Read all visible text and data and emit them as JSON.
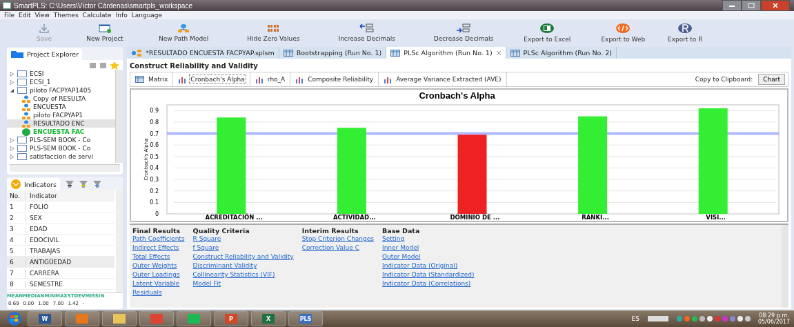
{
  "window": {
    "title": "SmartPLS: C:\\Users\\Víctor Cárdenas\\smartpls_workspace"
  },
  "menu": [
    "File",
    "Edit",
    "View",
    "Themes",
    "Calculate",
    "Info",
    "Language"
  ],
  "toolbar": [
    {
      "label": "Save",
      "disabled": true
    },
    {
      "label": "New Project",
      "disabled": false
    },
    {
      "label": "New Path Model",
      "disabled": false
    },
    {
      "label": "Hide Zero Values",
      "disabled": false
    },
    {
      "label": "Increase Decimals",
      "disabled": false
    },
    {
      "label": "Decrease Decimals",
      "disabled": false
    },
    {
      "label": "Export to Excel",
      "disabled": false
    },
    {
      "label": "Export to Web",
      "disabled": false
    },
    {
      "label": "Export to R",
      "disabled": false
    }
  ],
  "project_explorer": {
    "title": "Project Explorer",
    "items": [
      {
        "label": "ECSI",
        "kind": "project",
        "expanded": false,
        "selected": false
      },
      {
        "label": "ECSI_1",
        "kind": "project",
        "expanded": false,
        "selected": false
      },
      {
        "label": "piloto FACPYAP1405",
        "kind": "project",
        "expanded": true,
        "selected": false,
        "children": [
          {
            "label": "Copy of RESULTA",
            "kind": "model",
            "selected": false
          },
          {
            "label": "ENCUESTA",
            "kind": "model",
            "selected": false
          },
          {
            "label": "piloto FACPYAP1",
            "kind": "model",
            "selected": false
          },
          {
            "label": "RESULTADO ENC",
            "kind": "model",
            "selected": true
          },
          {
            "label": "ENCUESTA FAC",
            "kind": "data",
            "selected": false
          }
        ]
      },
      {
        "label": "PLS-SEM BOOK - Co",
        "kind": "project",
        "expanded": false,
        "selected": false
      },
      {
        "label": "PLS-SEM BOOK - Co",
        "kind": "project",
        "expanded": false,
        "selected": false
      },
      {
        "label": "satisfaccion de servi",
        "kind": "project",
        "expanded": false,
        "selected": false
      }
    ]
  },
  "indicators": {
    "title": "Indicators",
    "columns": [
      "No.",
      "Indicator"
    ],
    "rows": [
      {
        "no": "1",
        "name": "FOLIO",
        "selected": false
      },
      {
        "no": "2",
        "name": "SEX",
        "selected": false
      },
      {
        "no": "3",
        "name": "EDAD",
        "selected": false
      },
      {
        "no": "4",
        "name": "EDOCIVIL",
        "selected": false
      },
      {
        "no": "5",
        "name": "TRABAJAS",
        "selected": false
      },
      {
        "no": "6",
        "name": "ANTIGÜEDAD",
        "selected": true
      },
      {
        "no": "7",
        "name": "CARRERA",
        "selected": false
      },
      {
        "no": "8",
        "name": "SEMESTRE",
        "selected": false
      }
    ],
    "stats_columns": [
      "MEAN",
      "MEDIAN",
      "MIN",
      "MAX",
      "STDEV",
      "MISSIN"
    ],
    "stats_values": [
      "0.69",
      "0.00",
      "1.00",
      "7.00",
      "1.42",
      "-"
    ]
  },
  "editor_tabs": [
    {
      "label": "*RESULTADO ENCUESTA FACPYAP.splsm",
      "kind": "model",
      "selected": false,
      "closable": false
    },
    {
      "label": "Bootstrapping (Run No. 1)",
      "kind": "report",
      "selected": false,
      "closable": false
    },
    {
      "label": "PLSc Algorithm (Run No. 1)",
      "kind": "report",
      "selected": true,
      "closable": true
    },
    {
      "label": "PLSc Algorithm (Run No. 2)",
      "kind": "report",
      "selected": false,
      "closable": false
    }
  ],
  "report": {
    "title": "Construct Reliability and Validity",
    "view_tabs": [
      {
        "label": "Matrix",
        "kind": "matrix",
        "selected": false
      },
      {
        "label": "Cronbach's Alpha",
        "kind": "chart",
        "selected": true
      },
      {
        "label": "rho_A",
        "kind": "chart",
        "selected": false
      },
      {
        "label": "Composite Reliability",
        "kind": "chart",
        "selected": false
      },
      {
        "label": "Average Variance Extracted (AVE)",
        "kind": "chart",
        "selected": false
      }
    ],
    "clipboard_label": "Copy to Clipboard:",
    "clipboard_button": "Chart",
    "chart_data": {
      "type": "bar",
      "title": "Cronbach's Alpha",
      "ylabel": "Cronbach's Alpha",
      "categories": [
        "ACREDITACIÓN ...",
        "ACTIVIDAD...",
        "DOMINIO DE ...",
        "RANKI...",
        "VISI..."
      ],
      "series": [
        {
          "color": "#33ee33",
          "values": [
            0.84,
            0.75,
            null,
            0.85,
            0.92
          ]
        },
        {
          "color": "#ee2222",
          "values": [
            null,
            null,
            0.69,
            null,
            null
          ]
        }
      ],
      "ylim": [
        0,
        0.95
      ],
      "grid": true,
      "yticks": [
        {
          "value": 0,
          "label": "0"
        },
        {
          "value": 0.1,
          "label": "0.1"
        },
        {
          "value": 0.2,
          "label": "0.2"
        },
        {
          "value": 0.3,
          "label": "0.3"
        },
        {
          "value": 0.4,
          "label": "0.4"
        },
        {
          "value": 0.5,
          "label": "0.5"
        },
        {
          "value": 0.6,
          "label": "0.6"
        },
        {
          "value": 0.7,
          "label": "0.7"
        },
        {
          "value": 0.8,
          "label": "0.8"
        },
        {
          "value": 0.9,
          "label": "0.9"
        }
      ],
      "ref_lines": [
        {
          "axis": "y",
          "value": 0.7
        }
      ]
    }
  },
  "result_links": [
    {
      "heading": "Final Results",
      "links": [
        "Path Coefficients",
        "Indirect Effects",
        "Total Effects",
        "Outer Weights",
        "Outer Loadings",
        "Latent Variable",
        "Residuals"
      ]
    },
    {
      "heading": "Quality Criteria",
      "links": [
        "R Square",
        "f Square",
        "Construct Reliability and Validity",
        "Discriminant Validity",
        "Collinearity Statistics (VIF)",
        "Model Fit"
      ]
    },
    {
      "heading": "Interim Results",
      "links": [
        "Stop Criterion Changes",
        "Correction Value C"
      ]
    },
    {
      "heading": "Base Data",
      "links": [
        "Setting",
        "Inner Model",
        "Outer Model",
        "Indicator Data (Original)",
        "Indicator Data (Standardized)",
        "Indicator Data (Correlations)"
      ]
    }
  ],
  "taskbar": {
    "apps": [
      {
        "kind": "word",
        "label": "W"
      },
      {
        "kind": "media"
      },
      {
        "kind": "folder"
      },
      {
        "kind": "chrome"
      },
      {
        "kind": "spotify"
      },
      {
        "kind": "ppt",
        "label": "P"
      },
      {
        "kind": "excel",
        "label": "X"
      },
      {
        "kind": "pls",
        "label": "PLS"
      }
    ],
    "language": "ES",
    "time": "08:29 p.m.",
    "date": "05/06/2017"
  }
}
